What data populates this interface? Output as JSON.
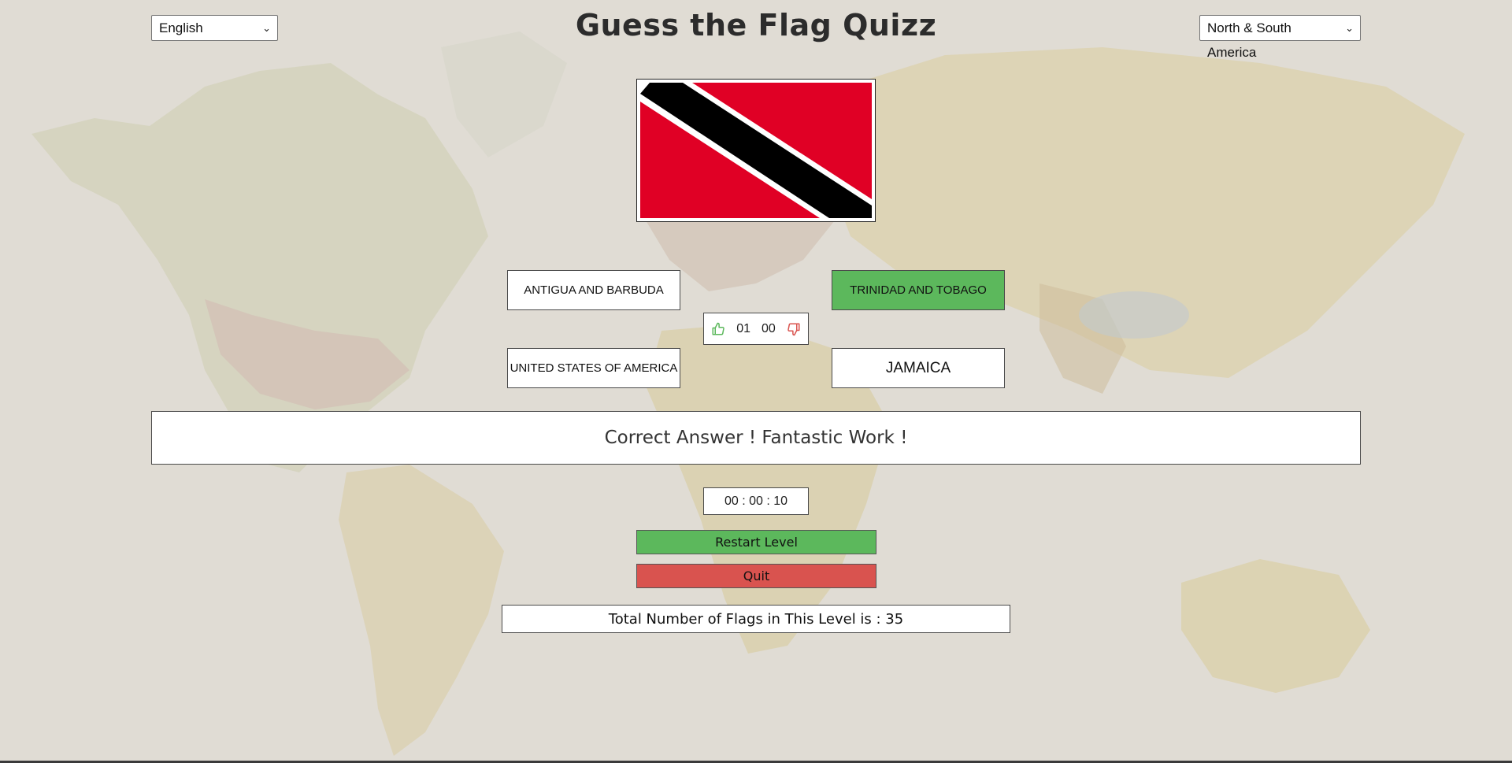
{
  "app": {
    "title": "Guess the Flag Quizz"
  },
  "language_select": {
    "selected": "English"
  },
  "region_select": {
    "selected": "North & South America"
  },
  "flag": {
    "icon": "trinidad-and-tobago-flag",
    "colors": {
      "red": "#E00025",
      "black": "#000000",
      "white": "#FFFFFF"
    }
  },
  "answers": [
    {
      "label": "ANTIGUA AND BARBUDA",
      "state": "default"
    },
    {
      "label": "TRINIDAD AND TOBAGO",
      "state": "correct"
    },
    {
      "label": "UNITED STATES OF AMERICA",
      "state": "default"
    },
    {
      "label": "JAMAICA",
      "state": "default"
    }
  ],
  "score": {
    "correct": "01",
    "wrong": "00",
    "correct_icon": "thumbs-up-icon",
    "wrong_icon": "thumbs-down-icon",
    "correct_color": "#5cb85c",
    "wrong_color": "#d9534f"
  },
  "message": "Correct Answer ! Fantastic Work !",
  "timer": "00 : 00 : 10",
  "buttons": {
    "restart": "Restart Level",
    "quit": "Quit"
  },
  "total": "Total Number of Flags in This Level is : 35",
  "theme": {
    "green": "#5cb85c",
    "red": "#d9534f"
  }
}
